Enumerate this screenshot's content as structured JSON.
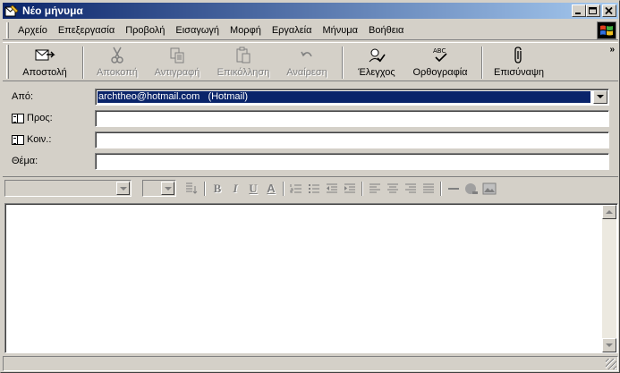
{
  "window": {
    "title": "Νέο μήνυμα",
    "minimize_label": "_",
    "maximize_label": "□",
    "close_label": "×"
  },
  "menu": {
    "items": [
      {
        "label": "Αρχείο"
      },
      {
        "label": "Επεξεργασία"
      },
      {
        "label": "Προβολή"
      },
      {
        "label": "Εισαγωγή"
      },
      {
        "label": "Μορφή"
      },
      {
        "label": "Εργαλεία"
      },
      {
        "label": "Μήνυμα"
      },
      {
        "label": "Βοήθεια"
      }
    ]
  },
  "toolbar": {
    "send_label": "Αποστολή",
    "cut_label": "Αποκοπή",
    "copy_label": "Αντιγραφή",
    "paste_label": "Επικόλληση",
    "undo_label": "Αναίρεση",
    "check_label": "Έλεγχος",
    "spelling_label": "Ορθογραφία",
    "attach_label": "Επισύναψη",
    "more_label": "»"
  },
  "header": {
    "from_label": "Από:",
    "from_value": "archtheo@hotmail.com   (Hotmail)",
    "to_label": "Προς:",
    "to_value": "",
    "cc_label": "Κοιν.:",
    "cc_value": "",
    "subject_label": "Θέμα:",
    "subject_value": ""
  },
  "format": {
    "font_value": "",
    "size_value": "",
    "bold": "B",
    "italic": "I",
    "underline": "U",
    "font_color": "A"
  },
  "colors": {
    "titlebar_start": "#0a246a",
    "titlebar_end": "#a6caf0",
    "face": "#d4d0c8",
    "selection": "#0a246a"
  }
}
